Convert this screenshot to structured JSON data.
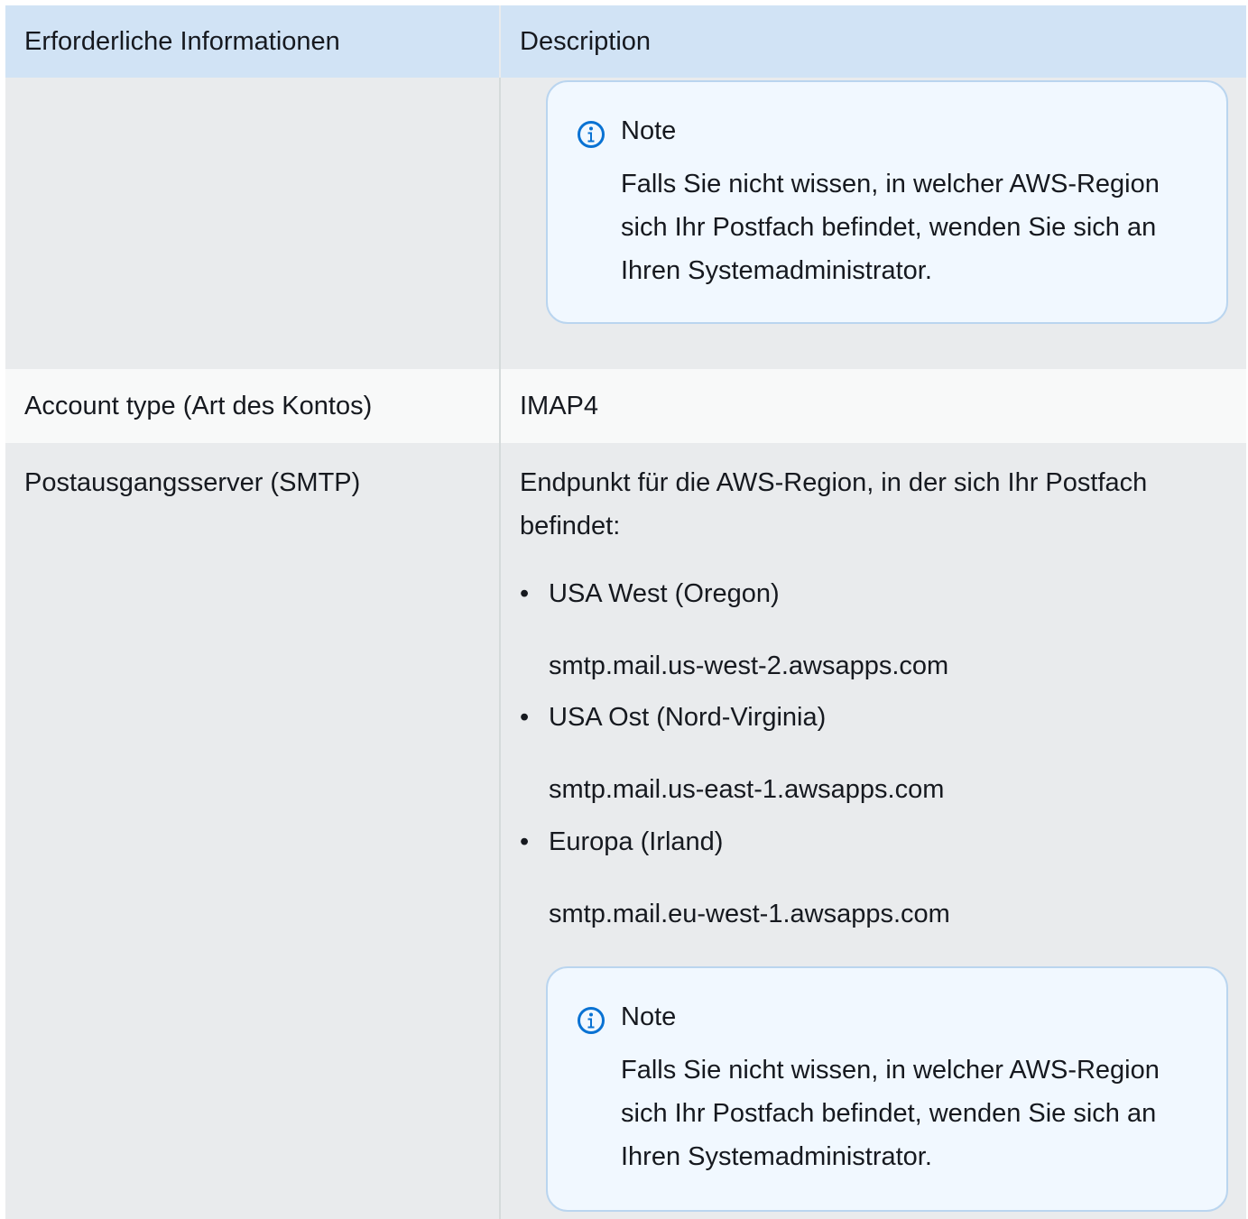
{
  "table": {
    "header": {
      "col1": "Erforderliche Informationen",
      "col2": "Description"
    },
    "rows": [
      {
        "label": "",
        "note": {
          "title": "Note",
          "body": "Falls Sie nicht wissen, in welcher AWS-Region sich Ihr Postfach befindet, wenden Sie sich an Ihren Systemadministrator."
        }
      },
      {
        "label": "Account type (Art des Kontos)",
        "value": "IMAP4"
      },
      {
        "label": "Postausgangsserver (SMTP)",
        "intro": "Endpunkt für die AWS-Region, in der sich Ihr Postfach befindet:",
        "regions": [
          {
            "name": "USA West (Oregon)",
            "endpoint": "smtp.mail.us-west-2.awsapps.com"
          },
          {
            "name": "USA Ost (Nord-Virginia)",
            "endpoint": "smtp.mail.us-east-1.awsapps.com"
          },
          {
            "name": "Europa (Irland)",
            "endpoint": "smtp.mail.eu-west-1.awsapps.com"
          }
        ],
        "note": {
          "title": "Note",
          "body": "Falls Sie nicht wissen, in welcher AWS-Region sich Ihr Postfach befindet, wenden Sie sich an Ihren Systemadministrator."
        }
      }
    ]
  },
  "colors": {
    "header_bg": "#d1e3f5",
    "row_bg_dark": "#e9ebed",
    "row_bg_light": "#f8f9f9",
    "note_bg": "#f1f8ff",
    "note_border": "#bad5ef",
    "info_icon": "#0972d3"
  },
  "icons": {
    "note_icon": "info-circle-icon"
  }
}
